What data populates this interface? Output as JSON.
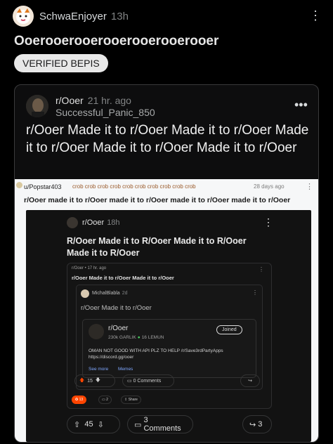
{
  "post": {
    "author": "SchwaEnjoyer",
    "time": "13h",
    "title": "Ooerooerooerooerooerooerooer",
    "flair": "VERIFIED BEPIS"
  },
  "crosspost": {
    "subreddit": "r/Ooer",
    "time": "21 hr. ago",
    "user": "Successful_Panic_850",
    "title": "r/Ooer Made it to r/Ooer Made it to r/Ooer Made it to r/Ooer Made it to r/Ooer Made it to r/Ooer"
  },
  "screenshot": {
    "user": "u/Popstar403",
    "awards": "crob crob crob crob crob crob crob crob crob crob",
    "age": "28 days ago",
    "title": "r/Ooer made it to r/Ooer made it to r/Ooer made it to r/Ooer made it to r/Ooer",
    "inner": {
      "subreddit": "r/Ooer",
      "time": "18h",
      "title": "R/Ooer Made it to R/Ooer Made it to R/Ooer Made it to R/Ooer",
      "nested": {
        "meta": "r/Ooer • 17 hr. ago",
        "title": "r/Ooer Made it to r/Ooer Made it to r/Ooer",
        "user": "MichalBlabla",
        "user_time": "2d",
        "comment_title": "r/Ooer Made it to r/Ooer",
        "community": {
          "name": "r/Ooer",
          "members": "230k GARLIK",
          "online": "16 LEMUN",
          "join_label": "Joined",
          "body": "OMAN NOT GOOD WITH API PLZ TO HELP /r/Save3rdPartyApps https://discord.gg/ooer",
          "see_more": "See more",
          "memes": "Memes"
        },
        "upvotes": "15",
        "comments_label": "0 Comments",
        "award_count": "13",
        "chip2": "2",
        "share_label": "Share"
      },
      "upvotes": "45",
      "comments_label": "3 Comments",
      "shares": "3"
    }
  }
}
